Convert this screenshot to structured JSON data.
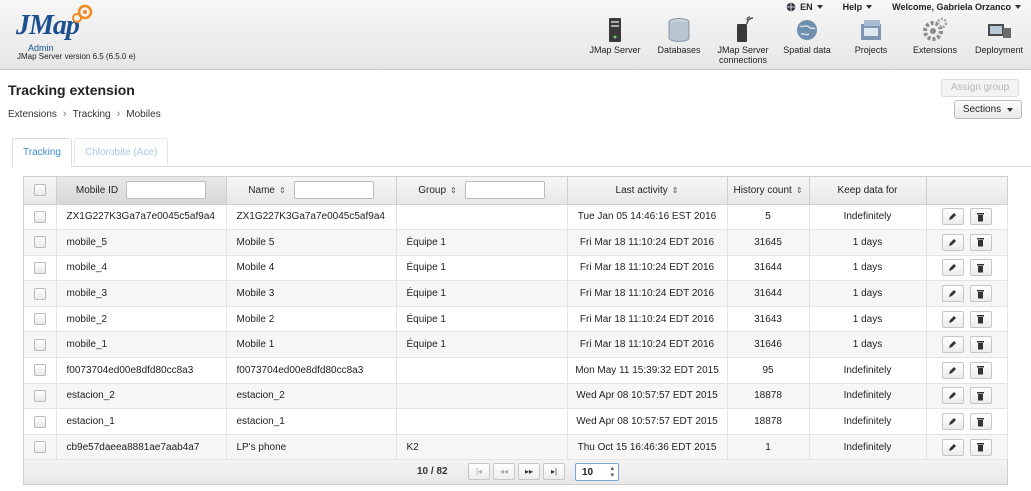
{
  "header": {
    "logo_text": "JMap",
    "logo_sub": "Admin",
    "version": "JMap Server version 6.5 (6.5.0 e)",
    "top_menu": {
      "language": "EN",
      "help": "Help",
      "welcome": "Welcome, Gabriela Orzanco"
    },
    "nav": [
      {
        "label": "JMap Server",
        "icon": "server-icon"
      },
      {
        "label": "Databases",
        "icon": "database-icon"
      },
      {
        "label": "JMap Server connections",
        "icon": "connections-icon"
      },
      {
        "label": "Spatial data",
        "icon": "globe-icon"
      },
      {
        "label": "Projects",
        "icon": "projects-icon"
      },
      {
        "label": "Extensions",
        "icon": "gear-icon"
      },
      {
        "label": "Deployment",
        "icon": "deployment-icon"
      }
    ]
  },
  "page": {
    "title": "Tracking extension",
    "breadcrumb": [
      "Extensions",
      "Tracking",
      "Mobiles"
    ],
    "assign_group": "Assign group",
    "sections": "Sections"
  },
  "tabs": [
    "Tracking",
    "Chlorobite (Ace)"
  ],
  "table": {
    "columns": [
      "Mobile ID",
      "Name",
      "Group",
      "Last activity",
      "History count",
      "Keep data for"
    ],
    "rows": [
      {
        "id": "ZX1G227K3Ga7a7e0045c5af9a4",
        "name": "ZX1G227K3Ga7a7e0045c5af9a4",
        "group": "",
        "last": "Tue Jan 05 14:46:16 EST 2016",
        "count": "5",
        "keep": "Indefinitely"
      },
      {
        "id": "mobile_5",
        "name": "Mobile 5",
        "group": "Équipe 1",
        "last": "Fri Mar 18 11:10:24 EDT 2016",
        "count": "31645",
        "keep": "1 days"
      },
      {
        "id": "mobile_4",
        "name": "Mobile 4",
        "group": "Équipe 1",
        "last": "Fri Mar 18 11:10:24 EDT 2016",
        "count": "31644",
        "keep": "1 days"
      },
      {
        "id": "mobile_3",
        "name": "Mobile 3",
        "group": "Équipe 1",
        "last": "Fri Mar 18 11:10:24 EDT 2016",
        "count": "31644",
        "keep": "1 days"
      },
      {
        "id": "mobile_2",
        "name": "Mobile 2",
        "group": "Équipe 1",
        "last": "Fri Mar 18 11:10:24 EDT 2016",
        "count": "31643",
        "keep": "1 days"
      },
      {
        "id": "mobile_1",
        "name": "Mobile 1",
        "group": "Équipe 1",
        "last": "Fri Mar 18 11:10:24 EDT 2016",
        "count": "31646",
        "keep": "1 days"
      },
      {
        "id": "f0073704ed00e8dfd80cc8a3",
        "name": "f0073704ed00e8dfd80cc8a3",
        "group": "",
        "last": "Mon May 11 15:39:32 EDT 2015",
        "count": "95",
        "keep": "Indefinitely"
      },
      {
        "id": "estacion_2",
        "name": "estacion_2",
        "group": "",
        "last": "Wed Apr 08 10:57:57 EDT 2015",
        "count": "18878",
        "keep": "Indefinitely"
      },
      {
        "id": "estacion_1",
        "name": "estacion_1",
        "group": "",
        "last": "Wed Apr 08 10:57:57 EDT 2015",
        "count": "18878",
        "keep": "Indefinitely"
      },
      {
        "id": "cb9e57daeea8881ae7aab4a7",
        "name": "LP's phone",
        "group": "K2",
        "last": "Thu Oct 15 16:46:36 EDT 2015",
        "count": "1",
        "keep": "Indefinitely"
      }
    ]
  },
  "pager": {
    "page_count": "10 / 82",
    "first": "|◂",
    "prev": "◂◂",
    "next": "▸▸",
    "last": "▸|",
    "page_size": "10"
  },
  "colors": {
    "accent": "#3b8fd2",
    "logo": "#1c4f8f",
    "gear": "#f08a1c"
  }
}
